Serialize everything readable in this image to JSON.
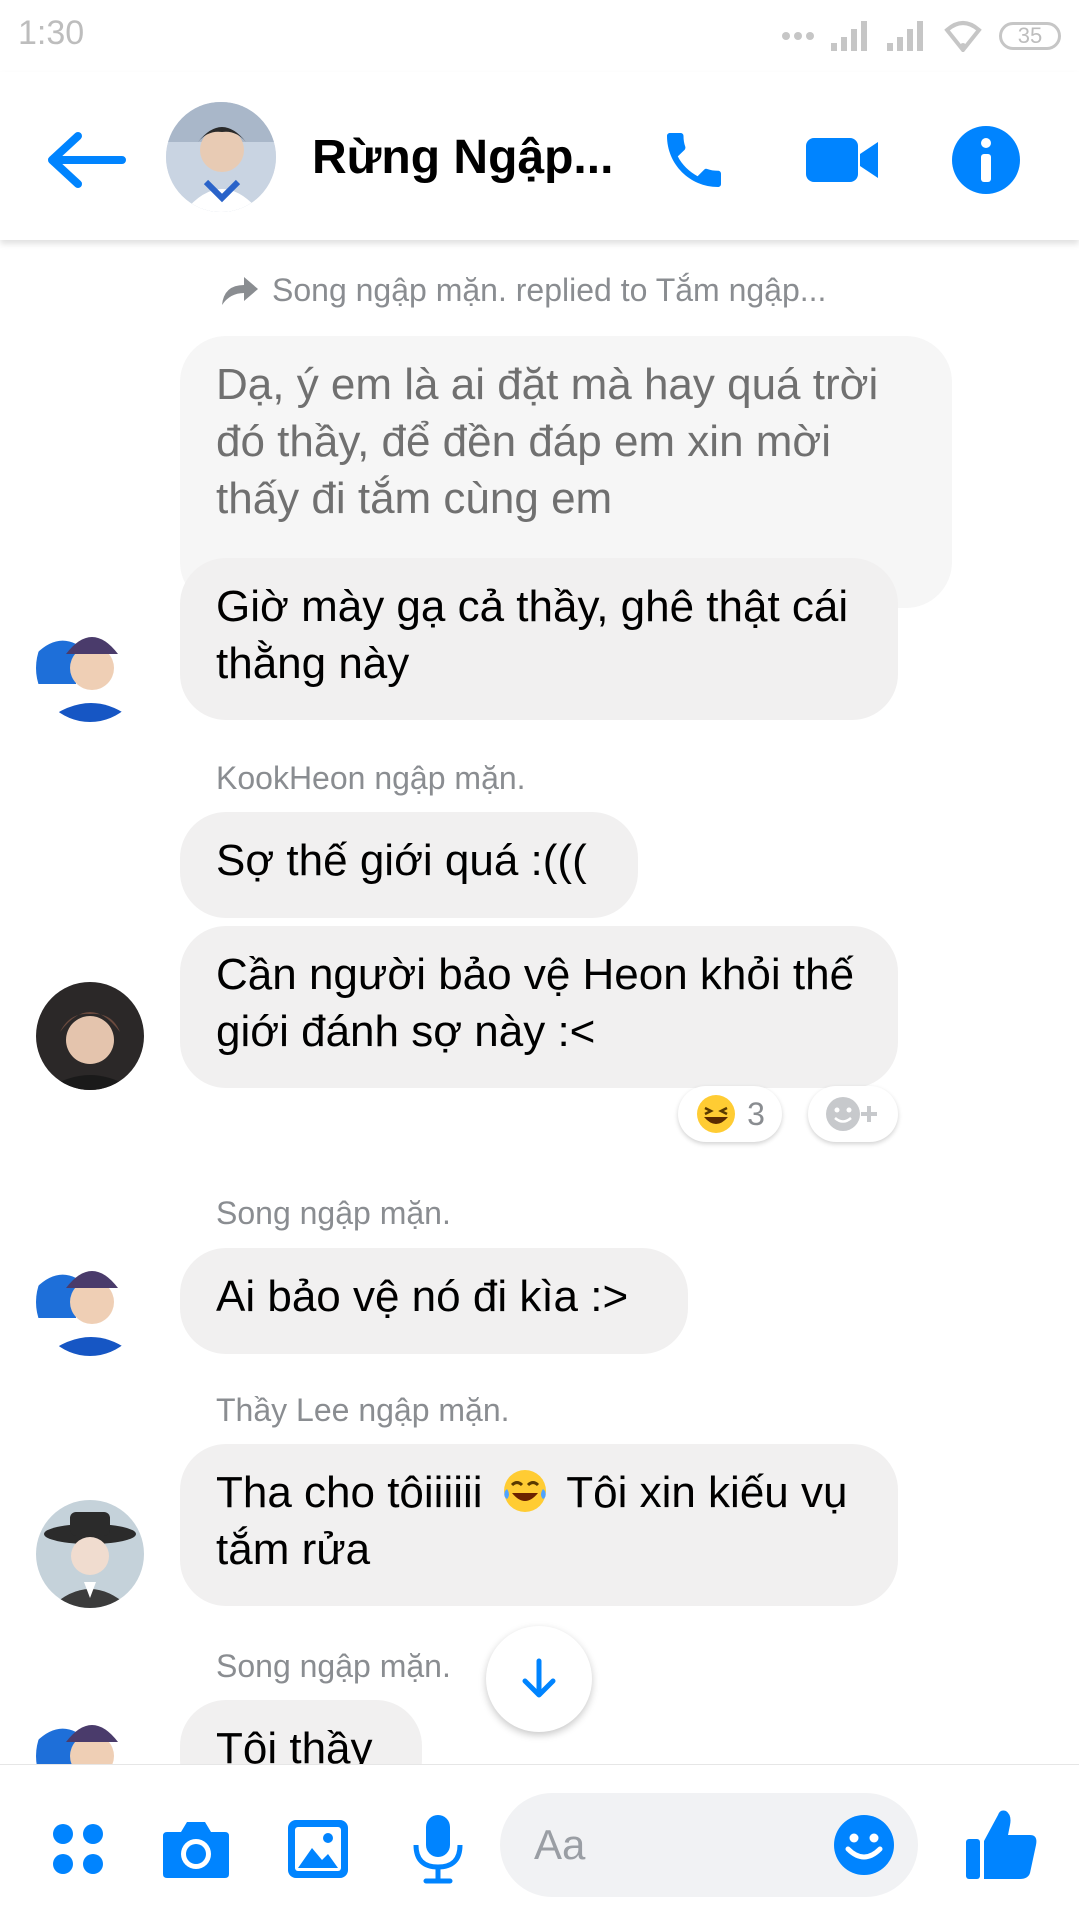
{
  "status": {
    "time": "1:30",
    "battery": "35"
  },
  "header": {
    "title": "Rừng Ngập..."
  },
  "thread": {
    "reply_note": "Song ngập mặn. replied to Tắm ngập...",
    "quoted_message": "Dạ, ý em là ai đặt mà hay quá trời đó thầy, để đền đáp em xin mời thấy đi tắm cùng em",
    "reply_message": "Giờ mày gạ cả thầy, ghê thật cái thằng này",
    "groups": [
      {
        "sender": "KookHeon ngập mặn.",
        "messages": [
          "Sợ thế giới quá :(((",
          "Cần người bảo vệ Heon khỏi thế giới đánh sợ này :<"
        ],
        "reaction_count": "3"
      },
      {
        "sender": "Song ngập mặn.",
        "messages": [
          "Ai bảo vệ nó đi kìa :>"
        ]
      },
      {
        "sender": "Thầy Lee ngập mặn.",
        "messages": [
          "Tha cho tôiiiiii",
          "Tôi xin kiếu vụ tắm rửa"
        ]
      },
      {
        "sender": "Song ngập mặn.",
        "messages": [
          "Tôi thầy"
        ]
      }
    ]
  },
  "composer": {
    "placeholder": "Aa"
  },
  "colors": {
    "accent": "#0084ff",
    "bubble": "#f1f0f0",
    "meta_text": "#8a8d91"
  },
  "icons": [
    "back-arrow-icon",
    "phone-icon",
    "video-camera-icon",
    "info-icon",
    "forward-reply-icon",
    "grin-emoji-icon",
    "add-reaction-icon",
    "down-arrow-icon",
    "apps-icon",
    "camera-icon",
    "gallery-icon",
    "microphone-icon",
    "emoji-icon",
    "thumbs-up-icon"
  ]
}
